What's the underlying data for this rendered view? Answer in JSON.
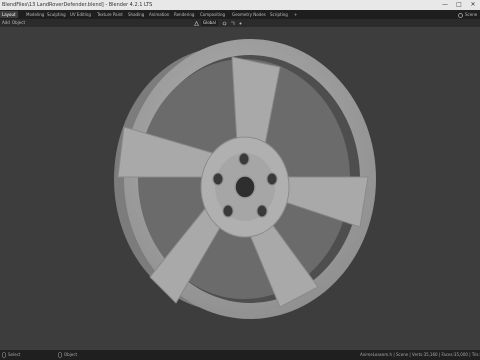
{
  "window": {
    "title": "BlendFiles\\13 LandRoverDefender.blend] - Blender 4.2.1 LTS",
    "controls": {
      "minimize": "—",
      "maximize": "□",
      "close": "✕"
    }
  },
  "workspaces": {
    "tabs": [
      {
        "label": "Layout",
        "active": true
      },
      {
        "label": "Modeling",
        "active": false
      },
      {
        "label": "Sculpting",
        "active": false
      },
      {
        "label": "UV Editing",
        "active": false
      },
      {
        "label": "Texture Paint",
        "active": false
      },
      {
        "label": "Shading",
        "active": false
      },
      {
        "label": "Animation",
        "active": false
      },
      {
        "label": "Rendering",
        "active": false
      },
      {
        "label": "Compositing",
        "active": false
      },
      {
        "label": "Geometry Nodes",
        "active": false
      },
      {
        "label": "Scripting",
        "active": false
      }
    ],
    "add_label": "+",
    "scene_label": "Scene"
  },
  "header": {
    "menu_add": "Add",
    "menu_object": "Object",
    "transform_orientation": "Global"
  },
  "status": {
    "left": "Select",
    "middle": "Object",
    "right": "AnimeLeasem.h | Scene | Verts:35,160 | Faces:35,000 | Tris:70,000"
  },
  "colors": {
    "viewport_bg": "#3d3d3d",
    "wheel_face": "#a8a8a8",
    "wheel_shadow": "#6a6a6a",
    "titlebar_bg": "#e8e8e8"
  }
}
